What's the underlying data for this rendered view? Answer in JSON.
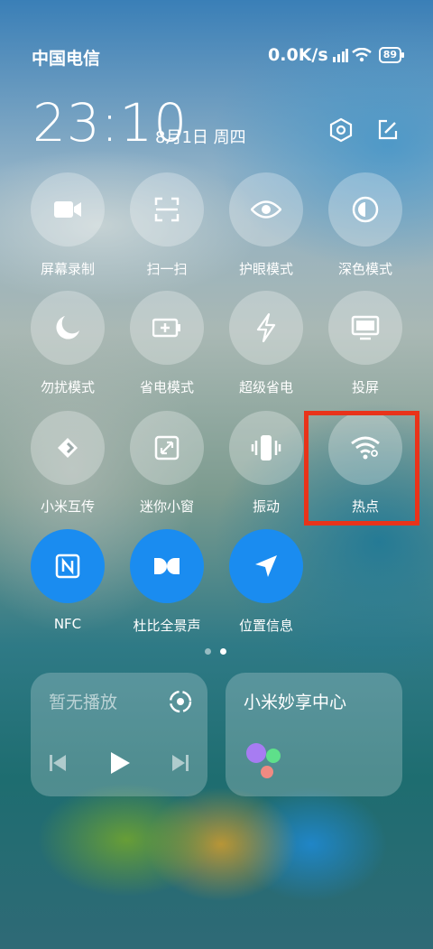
{
  "status": {
    "carrier": "中国电信",
    "network_speed": "0.0K/s",
    "battery": "89"
  },
  "header": {
    "time": "23:10",
    "date": "8月1日 周四"
  },
  "tiles": [
    {
      "label": "屏幕录制",
      "icon": "video-camera-icon",
      "active": false
    },
    {
      "label": "扫一扫",
      "icon": "scan-icon",
      "active": false
    },
    {
      "label": "护眼模式",
      "icon": "eye-icon",
      "active": false
    },
    {
      "label": "深色模式",
      "icon": "dark-mode-icon",
      "active": false
    },
    {
      "label": "勿扰模式",
      "icon": "moon-icon",
      "active": false
    },
    {
      "label": "省电模式",
      "icon": "battery-saver-icon",
      "active": false
    },
    {
      "label": "超级省电",
      "icon": "lightning-icon",
      "active": false
    },
    {
      "label": "投屏",
      "icon": "screen-cast-icon",
      "active": false
    },
    {
      "label": "小米互传",
      "icon": "mi-share-icon",
      "active": false
    },
    {
      "label": "迷你小窗",
      "icon": "mini-window-icon",
      "active": false
    },
    {
      "label": "振动",
      "icon": "vibrate-icon",
      "active": false
    },
    {
      "label": "热点",
      "icon": "hotspot-icon",
      "active": false
    },
    {
      "label": "NFC",
      "icon": "nfc-icon",
      "active": true
    },
    {
      "label": "杜比全景声",
      "icon": "dolby-icon",
      "active": true
    },
    {
      "label": "位置信息",
      "icon": "location-icon",
      "active": true
    }
  ],
  "media_card": {
    "title": "暂无播放"
  },
  "mi_share_card": {
    "title": "小米妙享中心"
  },
  "colors": {
    "active_tile": "#1a8cf0",
    "highlight": "#e9331a"
  }
}
